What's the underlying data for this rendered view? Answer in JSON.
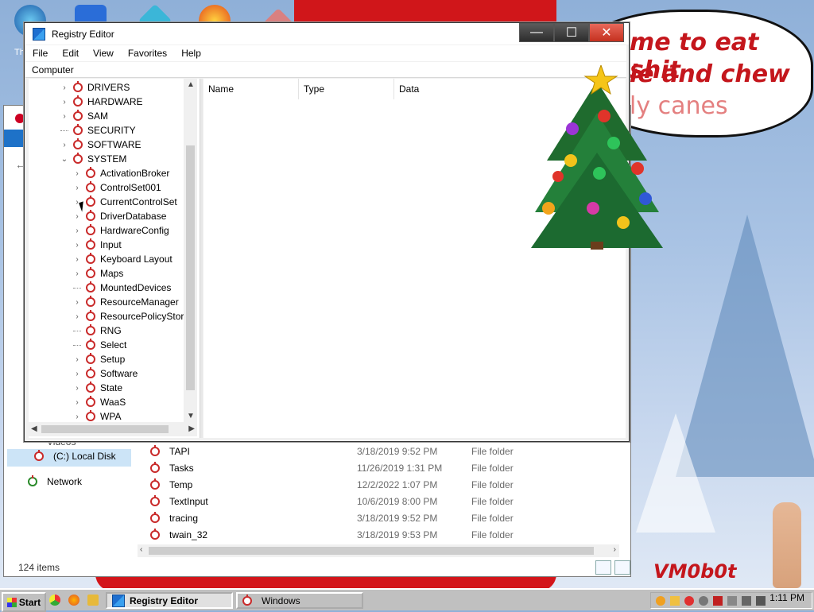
{
  "desktop": {
    "bubble_lines": [
      "me to eat shit",
      "ie and chew",
      "ly canes"
    ],
    "signature": "VM0b0t",
    "icon_label": "Th"
  },
  "explorer": {
    "videos_label": "Videos",
    "nav": {
      "local_disk": "(C:) Local Disk",
      "network": "Network"
    },
    "files": [
      {
        "name": "TAPI",
        "date": "3/18/2019 9:52 PM",
        "type": "File folder"
      },
      {
        "name": "Tasks",
        "date": "11/26/2019 1:31 PM",
        "type": "File folder"
      },
      {
        "name": "Temp",
        "date": "12/2/2022 1:07 PM",
        "type": "File folder"
      },
      {
        "name": "TextInput",
        "date": "10/6/2019 8:00 PM",
        "type": "File folder"
      },
      {
        "name": "tracing",
        "date": "3/18/2019 9:52 PM",
        "type": "File folder"
      },
      {
        "name": "twain_32",
        "date": "3/18/2019 9:53 PM",
        "type": "File folder"
      }
    ],
    "status": "124 items"
  },
  "regedit": {
    "title": "Registry Editor",
    "controls": {
      "minimize": "—",
      "maximize": "☐",
      "close": "✕"
    },
    "menu": [
      "File",
      "Edit",
      "View",
      "Favorites",
      "Help"
    ],
    "address": "Computer",
    "tree": [
      {
        "label": "DRIVERS",
        "level": 1,
        "expander": "collapsed"
      },
      {
        "label": "HARDWARE",
        "level": 1,
        "expander": "collapsed"
      },
      {
        "label": "SAM",
        "level": 1,
        "expander": "collapsed"
      },
      {
        "label": "SECURITY",
        "level": 1,
        "expander": "none"
      },
      {
        "label": "SOFTWARE",
        "level": 1,
        "expander": "collapsed"
      },
      {
        "label": "SYSTEM",
        "level": 1,
        "expander": "expanded"
      },
      {
        "label": "ActivationBroker",
        "level": 2,
        "expander": "collapsed"
      },
      {
        "label": "ControlSet001",
        "level": 2,
        "expander": "collapsed"
      },
      {
        "label": "CurrentControlSet",
        "level": 2,
        "expander": "collapsed"
      },
      {
        "label": "DriverDatabase",
        "level": 2,
        "expander": "collapsed"
      },
      {
        "label": "HardwareConfig",
        "level": 2,
        "expander": "collapsed"
      },
      {
        "label": "Input",
        "level": 2,
        "expander": "collapsed"
      },
      {
        "label": "Keyboard Layout",
        "level": 2,
        "expander": "collapsed"
      },
      {
        "label": "Maps",
        "level": 2,
        "expander": "collapsed"
      },
      {
        "label": "MountedDevices",
        "level": 2,
        "expander": "none"
      },
      {
        "label": "ResourceManager",
        "level": 2,
        "expander": "collapsed"
      },
      {
        "label": "ResourcePolicyStore",
        "level": 2,
        "expander": "collapsed"
      },
      {
        "label": "RNG",
        "level": 2,
        "expander": "none"
      },
      {
        "label": "Select",
        "level": 2,
        "expander": "none"
      },
      {
        "label": "Setup",
        "level": 2,
        "expander": "collapsed"
      },
      {
        "label": "Software",
        "level": 2,
        "expander": "collapsed"
      },
      {
        "label": "State",
        "level": 2,
        "expander": "collapsed"
      },
      {
        "label": "WaaS",
        "level": 2,
        "expander": "collapsed"
      },
      {
        "label": "WPA",
        "level": 2,
        "expander": "collapsed"
      }
    ],
    "columns": [
      "Name",
      "Type",
      "Data"
    ]
  },
  "taskbar": {
    "start_label": "Start",
    "tasks": [
      "Registry Editor",
      "Windows"
    ],
    "clock": "1:11 PM"
  },
  "colors": {
    "accent_red": "#c92a2a",
    "title_bg": "#ffffff",
    "taskbar": "#c0c0c0"
  }
}
